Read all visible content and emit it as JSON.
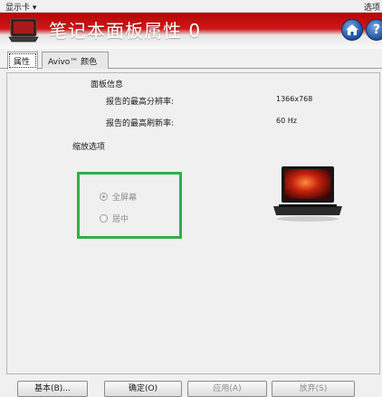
{
  "topbar": {
    "left_menu": "显示卡 ▾",
    "right_menu": "选项"
  },
  "banner": {
    "title": "笔记本面板属性 0",
    "home_icon": "home-icon",
    "help_icon": "help-icon",
    "help_symbol": "?"
  },
  "tabs": [
    {
      "label": "属性",
      "active": true
    },
    {
      "label": "Avivo™ 颜色",
      "active": false
    }
  ],
  "panel_info": {
    "legend": "面板信息",
    "rows": [
      {
        "label": "报告的最高分辨率:",
        "value": "1366x768"
      },
      {
        "label": "报告的最高刷新率:",
        "value": "60 Hz"
      }
    ]
  },
  "scaling": {
    "legend": "缩放选项",
    "options": [
      {
        "label": "全屏幕",
        "checked": true,
        "enabled": false
      },
      {
        "label": "居中",
        "checked": false,
        "enabled": false
      }
    ],
    "highlight_color": "#2fb04a"
  },
  "buttons": {
    "basic": "基本(B)...",
    "ok": "确定(O)",
    "apply": "应用(A)",
    "discard": "放弃(S)"
  },
  "colors": {
    "banner_red": "#c41010",
    "accent_blue": "#1d4f9e"
  }
}
